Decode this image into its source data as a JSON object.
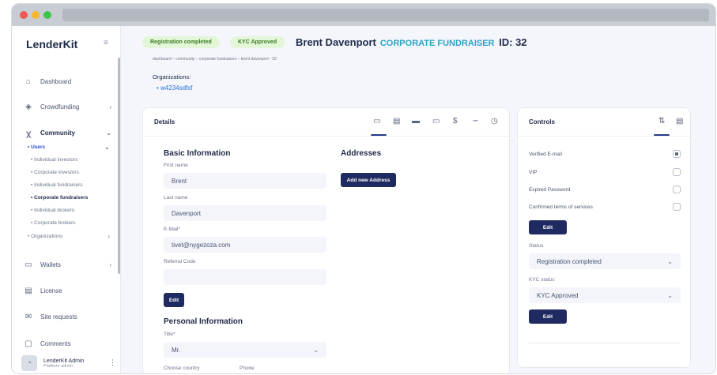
{
  "sidebar": {
    "logo": "LenderKit",
    "collapse_icon": "≡",
    "items": [
      {
        "label": "Dashboard",
        "icon": "home-icon"
      },
      {
        "label": "Crowdfunding",
        "icon": "layers-icon"
      },
      {
        "label": "Community",
        "icon": "users-icon"
      },
      {
        "label": "Wallets",
        "icon": "wallet-icon"
      },
      {
        "label": "License",
        "icon": "document-icon"
      },
      {
        "label": "Site requests",
        "icon": "mail-icon"
      },
      {
        "label": "Comments",
        "icon": "comment-icon"
      }
    ],
    "community_sub": {
      "users_label": "Users",
      "users_children": [
        "Individual investors",
        "Corporate investors",
        "Individual fundraisers",
        "Corporate fundraisers",
        "Individual brokers",
        "Corporate brokers"
      ],
      "organizations_label": "Organizations"
    },
    "user": {
      "name": "LenderKit Admin",
      "role": "Platform admin",
      "menu_glyph": "⋮"
    }
  },
  "header": {
    "badge_registration": "Registration completed",
    "badge_kyc": "KYC Approved",
    "name": "Brent Davenport",
    "role": "CORPORATE FUNDRAISER",
    "id_label": "ID: 32",
    "breadcrumb": "dashboard – community – corporate fundraisers – brent davenport - 32",
    "organizations_label": "Organizations:",
    "organization_link": "w4234sdfsf"
  },
  "details": {
    "title": "Details",
    "tab_icons": [
      "id-card-icon",
      "document-icon",
      "credit-card-icon",
      "card-icon",
      "dollar-icon",
      "handshake-icon",
      "clock-icon"
    ],
    "basic_info_title": "Basic Information",
    "first_name_label": "First name",
    "first_name_value": "Brent",
    "last_name_label": "Last name",
    "last_name_value": "Davenport",
    "email_label": "E-Mail*",
    "email_value": "tivet@nygezoza.com",
    "referral_label": "Referral Code",
    "referral_value": "",
    "edit_label": "Edit",
    "addresses_title": "Addresses",
    "add_address_label": "Add new Address",
    "personal_info_title": "Personal Information",
    "title_label": "Title*",
    "title_value": "Mr.",
    "country_label": "Choose country",
    "phone_label": "Phone"
  },
  "controls": {
    "title": "Controls",
    "checks": [
      {
        "label": "Verified E-mail",
        "checked": true
      },
      {
        "label": "VIP",
        "checked": false
      },
      {
        "label": "Expired Password",
        "checked": false
      },
      {
        "label": "Confirmed terms of services",
        "checked": false
      }
    ],
    "edit_label": "Edit",
    "status_label": "Status",
    "status_value": "Registration completed",
    "kyc_label": "KYC status",
    "kyc_value": "KYC Approved",
    "edit2_label": "Edit"
  },
  "colors": {
    "accent": "#1f2a60",
    "link": "#2a6fdc",
    "role": "#2aa4c7",
    "badge_bg": "#e3f6d8"
  }
}
